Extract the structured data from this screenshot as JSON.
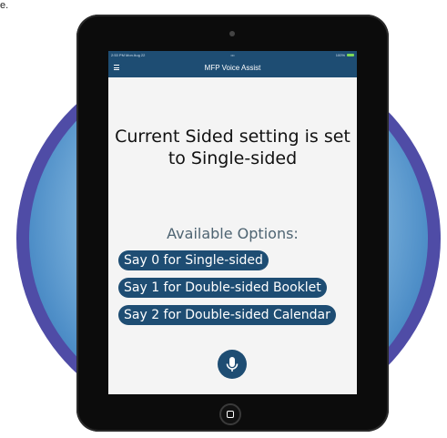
{
  "page": {
    "corner_text": "e."
  },
  "status_bar": {
    "time_date": "2:53 PM  Mon Aug 22",
    "dots": "•••",
    "battery": "100%"
  },
  "app_bar": {
    "title": "MFP Voice Assist"
  },
  "main": {
    "message": "Current Sided setting is set to Single-sided",
    "options_title": "Available Options:",
    "options": [
      {
        "label": "Say 0 for Single-sided"
      },
      {
        "label": "Say 1 for Double-sided Booklet"
      },
      {
        "label": "Say 2 for Double-sided Calendar"
      }
    ]
  },
  "icons": {
    "menu": "hamburger-menu-icon",
    "mic": "microphone-icon",
    "home": "home-button-icon"
  },
  "colors": {
    "primary": "#1e4d73",
    "ring": "#4f4ca6",
    "screen_bg": "#f4f4f4",
    "options_title": "#4e6472"
  }
}
